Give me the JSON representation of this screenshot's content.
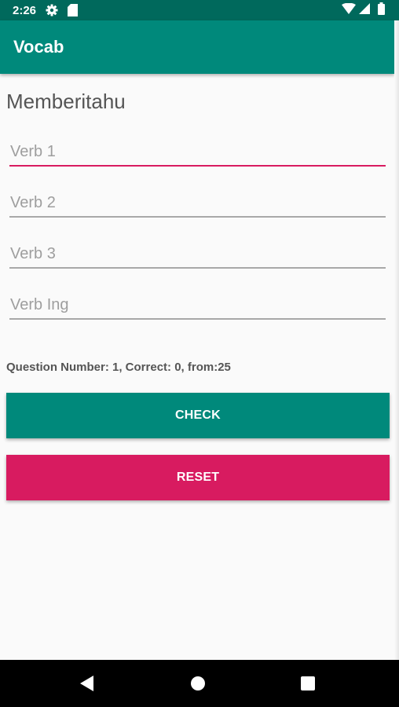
{
  "status_bar": {
    "time": "2:26",
    "icons": [
      "gear-icon",
      "sd-card-icon",
      "wifi-icon",
      "signal-icon",
      "battery-icon"
    ]
  },
  "app_bar": {
    "title": "Vocab"
  },
  "word": "Memberitahu",
  "fields": [
    {
      "placeholder": "Verb 1",
      "value": ""
    },
    {
      "placeholder": "Verb 2",
      "value": ""
    },
    {
      "placeholder": "Verb 3",
      "value": ""
    },
    {
      "placeholder": "Verb Ing",
      "value": ""
    }
  ],
  "progress_text": "Question Number: 1, Correct: 0, from:25",
  "buttons": {
    "check": "CHECK",
    "reset": "RESET"
  },
  "colors": {
    "primary": "#00897b",
    "primary_dark": "#00695c",
    "accent": "#d81b60"
  },
  "nav_bar": {
    "icons": [
      "back-icon",
      "home-icon",
      "recents-icon"
    ]
  }
}
